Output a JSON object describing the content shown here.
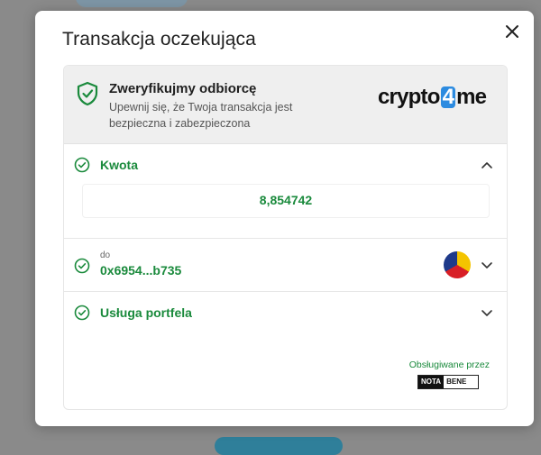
{
  "modal": {
    "title": "Transakcja oczekująca",
    "close_icon": "close-icon"
  },
  "verify": {
    "title": "Zweryfikujmy odbiorcę",
    "description": "Upewnij się, że Twoja transakcja jest bezpieczna i zabezpieczona",
    "icon": "shield-check-icon",
    "brand": {
      "part1": "crypto",
      "part2": "4",
      "part3": "me",
      "accent": "#2c8be0"
    }
  },
  "amount": {
    "label": "Kwota",
    "value": "8,854742",
    "expanded": true
  },
  "recipient": {
    "small_label": "do",
    "address": "0x6954...b735",
    "expanded": false
  },
  "wallet": {
    "label": "Usługa portfela",
    "powered_by": "Obsługiwane przez",
    "provider_a": "NOTA",
    "provider_b": "BENE",
    "expanded": false
  },
  "colors": {
    "accent_green": "#1a8a3c",
    "text_dark": "#1f1f1f"
  }
}
